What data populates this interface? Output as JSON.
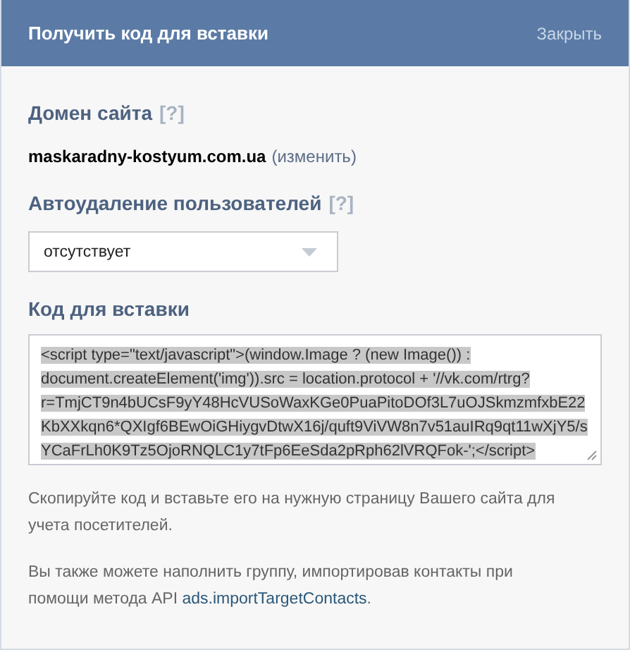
{
  "header": {
    "title": "Получить код для вставки",
    "close": "Закрыть"
  },
  "domain": {
    "heading": "Домен сайта",
    "help": "[?]",
    "value": "maskaradny-kostyum.com.ua",
    "change_link": "(изменить)"
  },
  "autodelete": {
    "heading": "Автоудаление пользователей",
    "help": "[?]",
    "select_value": "отсутствует"
  },
  "code": {
    "heading": "Код для вставки",
    "value": "<script type=\"text/javascript\">(window.Image ? (new Image()) : document.createElement('img')).src = location.protocol + '//vk.com/rtrg?r=TmjCT9n4bUCsF9yY48HcVUSoWaxKGe0PuaPitoDOf3L7uOJSkmzmfxbE22KbXXkqn6*QXIgf6BEwOiGHiygvDtwX16j/quft9ViVW8n7v51auIRq9qt11wXjY5/sYCaFrLh0K9Tz5OjoRNQLC1y7tFp6EeSda2pRph62lVRQFok-';</script>",
    "selected": true
  },
  "instructions": "Скопируйте код и вставьте его на нужную страницу Вашего сайта для учета посетителей.",
  "import_note": {
    "text_before": "Вы также можете наполнить группу, импортировав контакты при помощи метода API ",
    "link": "ads.importTargetContacts",
    "text_after": "."
  }
}
